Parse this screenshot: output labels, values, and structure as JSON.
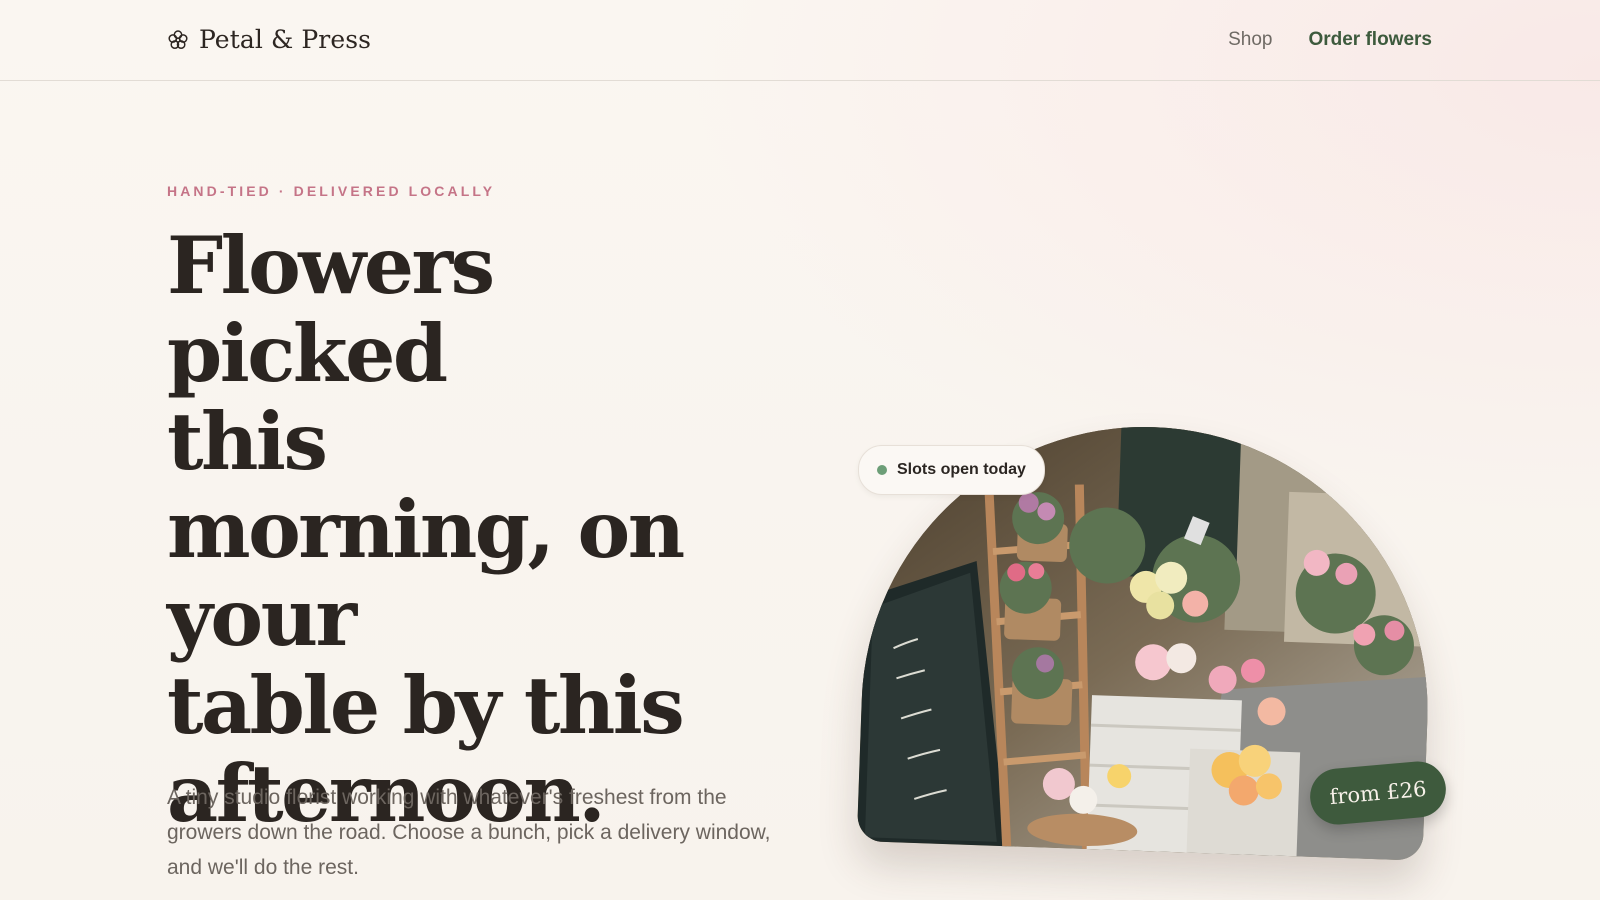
{
  "header": {
    "brand_name": "Petal & Press",
    "brand_icon": "flower-icon",
    "nav": {
      "shop_label": "Shop",
      "order_label": "Order flowers"
    }
  },
  "hero": {
    "eyebrow": "HAND-TIED · DELIVERED LOCALLY",
    "headline_lines": [
      "Flowers picked",
      "this",
      "morning, on",
      "your",
      "table by this",
      "afternoon."
    ],
    "lede": "A tiny studio florist working with whatever's freshest from the growers down the road. Choose a bunch, pick a delivery window, and we'll do the rest."
  },
  "media": {
    "status_pill": "Slots open today",
    "price_tag": "from £26"
  },
  "colors": {
    "accent_green": "#3e5a3d",
    "eyebrow_pink": "#c57487",
    "status_green": "#6c9e77"
  }
}
